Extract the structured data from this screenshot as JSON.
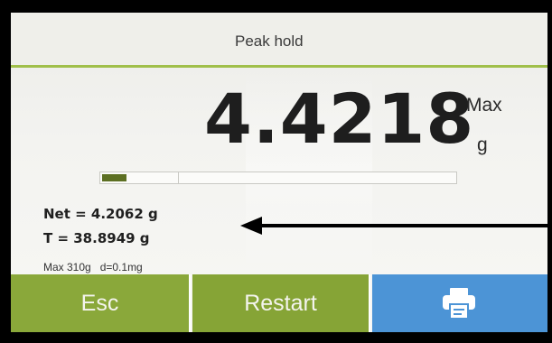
{
  "header": {
    "title": "Peak hold"
  },
  "display": {
    "weight": "4.4218",
    "mode": "Max",
    "unit": "g",
    "capacity_fraction": 0.07
  },
  "info": {
    "net": "Net = 4.2062 g",
    "tare": "T = 38.8949 g",
    "spec": "Max 310g   d=0.1mg"
  },
  "buttons": {
    "esc": "Esc",
    "restart": "Restart",
    "print_icon": "printer-icon"
  },
  "colors": {
    "accent_green": "#8aa83a",
    "print_blue": "#4c94d6",
    "capacity_fill": "#5c6f22"
  }
}
